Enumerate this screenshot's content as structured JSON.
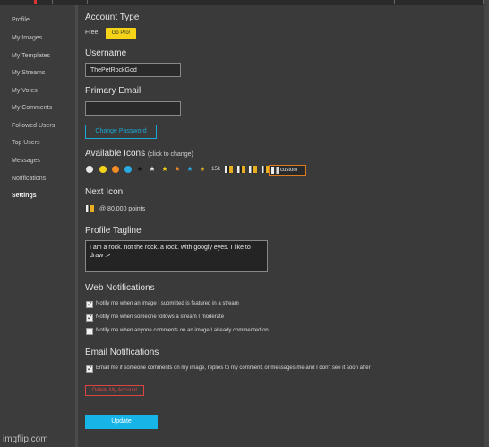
{
  "sidebar": {
    "items": [
      {
        "label": "Profile"
      },
      {
        "label": "My Images"
      },
      {
        "label": "My Templates"
      },
      {
        "label": "My Streams"
      },
      {
        "label": "My Votes"
      },
      {
        "label": "My Comments"
      },
      {
        "label": "Followed Users"
      },
      {
        "label": "Top Users"
      },
      {
        "label": "Messages"
      },
      {
        "label": "Notifications"
      },
      {
        "label": "Settings"
      }
    ]
  },
  "account": {
    "title": "Account Type",
    "type_value": "Free",
    "gopro_label": "Go Pro!"
  },
  "username": {
    "title": "Username",
    "value": "ThePetRockGod"
  },
  "email": {
    "title": "Primary Email",
    "value": ""
  },
  "change_password_label": "Change Password",
  "icons": {
    "title": "Available Icons",
    "hint": "(click to change)",
    "count_label": "15k",
    "custom_label": "custom"
  },
  "next_icon": {
    "title": "Next Icon",
    "points_text": "@ 80,000 points"
  },
  "tagline": {
    "title": "Profile Tagline",
    "value": "I am a rock. not the rock. a rock. with googly eyes. I like to draw :>"
  },
  "web_notifications": {
    "title": "Web Notifications",
    "options": [
      {
        "label": "Notify me when an image I submitted is featured in a stream",
        "checked": true
      },
      {
        "label": "Notify me when someone follows a stream I moderate",
        "checked": true
      },
      {
        "label": "Notify me when anyone comments on an image I already commented on",
        "checked": false
      }
    ]
  },
  "email_notifications": {
    "title": "Email Notifications",
    "options": [
      {
        "label": "Email me if someone comments on my image, replies to my comment, or messages me and I don't see it soon after",
        "checked": true
      }
    ]
  },
  "delete_label": "Delete My Account",
  "update_label": "Update",
  "watermark": "imgflip.com",
  "colors": {
    "accent_blue": "#17b4e8",
    "gopro_yellow": "#f5d417",
    "danger_red": "#dd4444",
    "custom_orange": "#e07a20"
  }
}
